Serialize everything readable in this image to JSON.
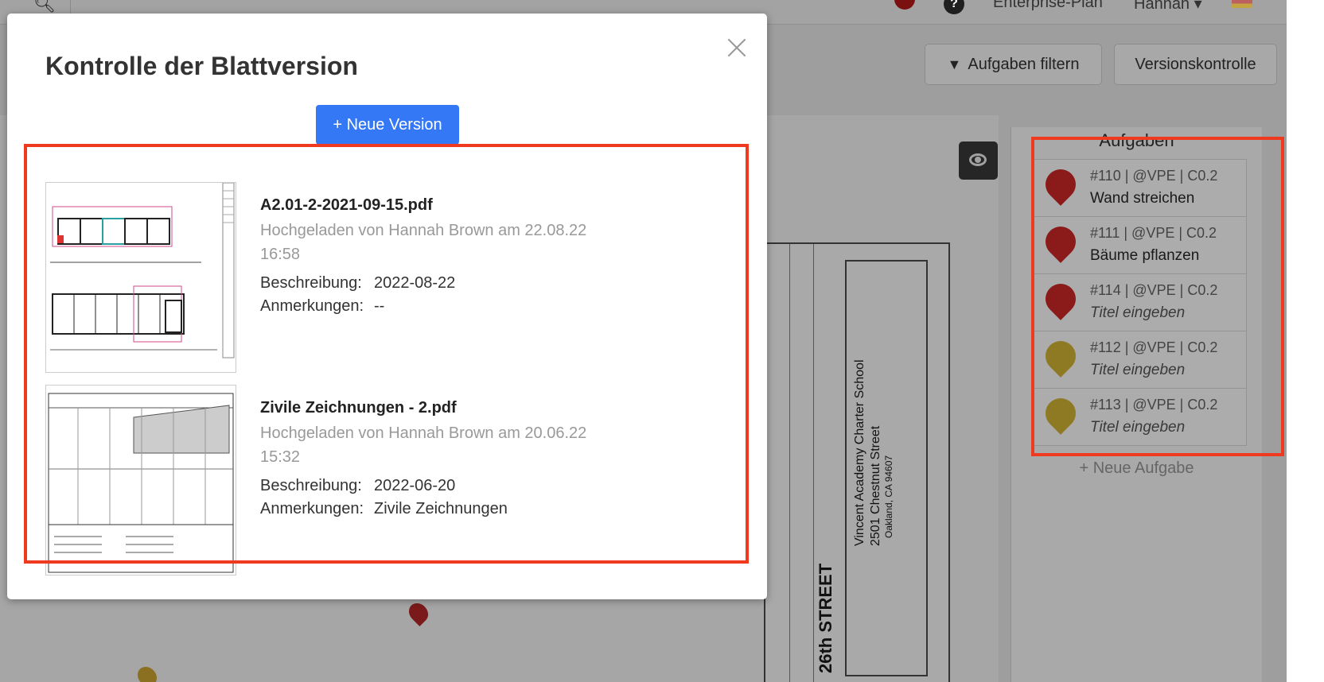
{
  "topbar": {
    "plan": "Enterprise-Plan",
    "user": "Hannah"
  },
  "toolbar": {
    "filter_label": "Aufgaben filtern",
    "version_label": "Versionskontrolle"
  },
  "drawing": {
    "school": "Vincent Academy Charter School",
    "address": "2501 Chestnut Street",
    "city": "Oakland, CA 94607",
    "street": "26th STREET"
  },
  "tasks_panel": {
    "title": "Aufgaben",
    "new_task": "+ Neue Aufgabe",
    "tasks": [
      {
        "meta": "#110 | @VPE | C0.2",
        "name": "Wand streichen",
        "color": "#8b1a1a",
        "placeholder": false
      },
      {
        "meta": "#111 | @VPE | C0.2",
        "name": "Bäume pflanzen",
        "color": "#8b1a1a",
        "placeholder": false
      },
      {
        "meta": "#114 | @VPE | C0.2",
        "name": "Titel eingeben",
        "color": "#8b1a1a",
        "placeholder": true
      },
      {
        "meta": "#112 | @VPE | C0.2",
        "name": "Titel eingeben",
        "color": "#8f7a24",
        "placeholder": true
      },
      {
        "meta": "#113 | @VPE | C0.2",
        "name": "Titel eingeben",
        "color": "#8f7a24",
        "placeholder": true
      }
    ]
  },
  "modal": {
    "title": "Kontrolle der Blattversion",
    "new_version": "+ Neue Version",
    "versions": [
      {
        "filename": "A2.01-2-2021-09-15.pdf",
        "uploaded": "Hochgeladen von Hannah Brown am 22.08.22 16:58",
        "desc_label": "Beschreibung:",
        "desc": "2022-08-22",
        "notes_label": "Anmerkungen:",
        "notes": "--"
      },
      {
        "filename": "Zivile Zeichnungen - 2.pdf",
        "uploaded": "Hochgeladen von Hannah Brown am 20.06.22 15:32",
        "desc_label": "Beschreibung:",
        "desc": "2022-06-20",
        "notes_label": "Anmerkungen:",
        "notes": "Zivile Zeichnungen"
      }
    ]
  },
  "colors": {
    "accent": "#3478f6",
    "highlight": "#f03a1f"
  }
}
